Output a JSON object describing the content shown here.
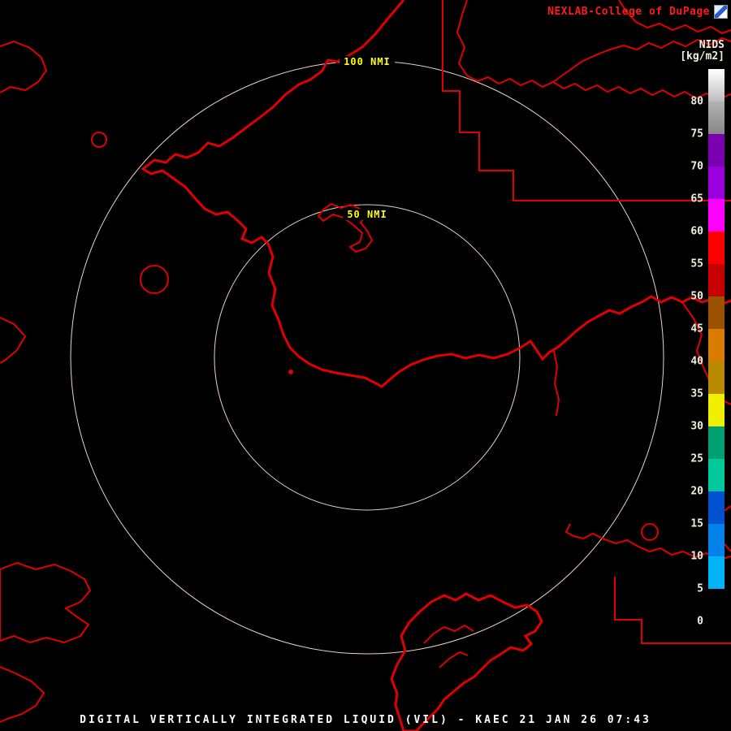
{
  "header": {
    "brand": "NEXLAB-College of DuPage"
  },
  "legend": {
    "title": "NIDS",
    "units": "[kg/m2]",
    "ticks": [
      80,
      75,
      70,
      65,
      60,
      55,
      50,
      45,
      40,
      35,
      30,
      25,
      20,
      15,
      10,
      5,
      0
    ],
    "segments_top_to_bottom": [
      {
        "range": ">80",
        "color": "#ffffff",
        "color2": "#bdbdbd"
      },
      {
        "range": "75-80",
        "color": "#b2b2b2",
        "color2": "#878787"
      },
      {
        "range": "70-75",
        "color": "#7a00b0"
      },
      {
        "range": "65-70",
        "color": "#9a00dd"
      },
      {
        "range": "60-65",
        "color": "#ff00ff"
      },
      {
        "range": "55-60",
        "color": "#ff0000"
      },
      {
        "range": "50-55",
        "color": "#c60000"
      },
      {
        "range": "45-50",
        "color": "#9b5200"
      },
      {
        "range": "40-45",
        "color": "#d97c00"
      },
      {
        "range": "35-40",
        "color": "#b98a00"
      },
      {
        "range": "30-35",
        "color": "#f0f000"
      },
      {
        "range": "25-30",
        "color": "#00a070"
      },
      {
        "range": "20-25",
        "color": "#00c89b"
      },
      {
        "range": "15-20",
        "color": "#0050d0"
      },
      {
        "range": "10-15",
        "color": "#0082e8"
      },
      {
        "range": "5-10",
        "color": "#00b4f5"
      },
      {
        "range": "0-5",
        "color": "#000000"
      }
    ],
    "below_bar_color": "#000000"
  },
  "rings": {
    "outer_label": "100 NMI",
    "inner_label": "50 NMI"
  },
  "footer": {
    "title": "DIGITAL VERTICALLY INTEGRATED LIQUID (VIL) - KAEC 21 JAN 26 07:43"
  },
  "colors": {
    "background": "#000000",
    "map_outline": "#e00000",
    "ring": "#f0d2c0",
    "ring_label": "#ffff00",
    "legend_text": "#f0f0dc",
    "brand_text": "#ff1a1a",
    "footer_text": "#ffffff"
  }
}
